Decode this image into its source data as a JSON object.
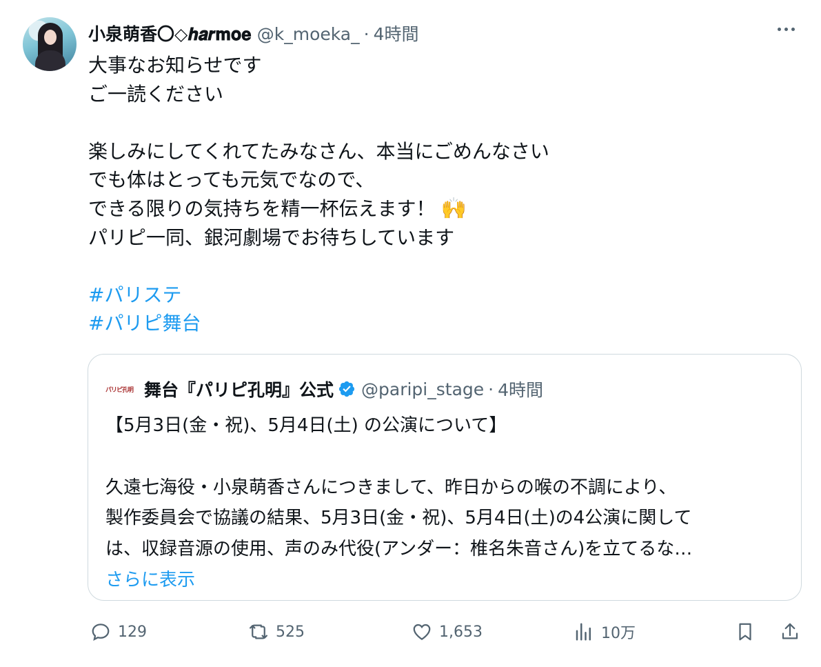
{
  "tweet": {
    "display_name": "小泉萌香〇◇𝒉𝒂𝒓𝐦𝐨𝐞",
    "handle": "@k_moeka_",
    "separator": "·",
    "time": "4時間",
    "lines": [
      "大事なお知らせです",
      "ご一読ください",
      "",
      "楽しみにしてくれてたみなさん、本当にごめんなさい",
      "でも体はとっても元気でなので、",
      "できる限りの気持ちを精一杯伝えます！",
      "パリピ一同、銀河劇場でお待ちしています",
      ""
    ],
    "emoji": "🙌",
    "hashtags": [
      "#パリステ",
      "#パリピ舞台"
    ]
  },
  "quote": {
    "logo_text": "パリピ孔明",
    "display_name": "舞台『パリピ孔明』公式",
    "handle": "@paripi_stage",
    "separator": "·",
    "time": "4時間",
    "lines": [
      "【5月3日(金・祝)、5月4日(土) の公演について】",
      "",
      "久遠七海役・小泉萌香さんにつきまして、昨日からの喉の不調により、",
      "製作委員会で協議の結果、5月3日(金・祝)、5月4日(土)の4公演に関して",
      "は、収録音源の使用、声のみ代役(アンダー：椎名朱音さん)を立てるな…"
    ],
    "show_more": "さらに表示"
  },
  "actions": {
    "reply_count": "129",
    "retweet_count": "525",
    "like_count": "1,653",
    "view_count": "10万"
  },
  "colors": {
    "link": "#1d9bf0",
    "secondary_text": "#536471",
    "border": "#cfd9de",
    "verified": "#1d9bf0"
  },
  "icons": [
    "more-icon",
    "verified-badge-icon",
    "reply-icon",
    "retweet-icon",
    "like-icon",
    "views-icon",
    "bookmark-icon",
    "share-icon"
  ]
}
